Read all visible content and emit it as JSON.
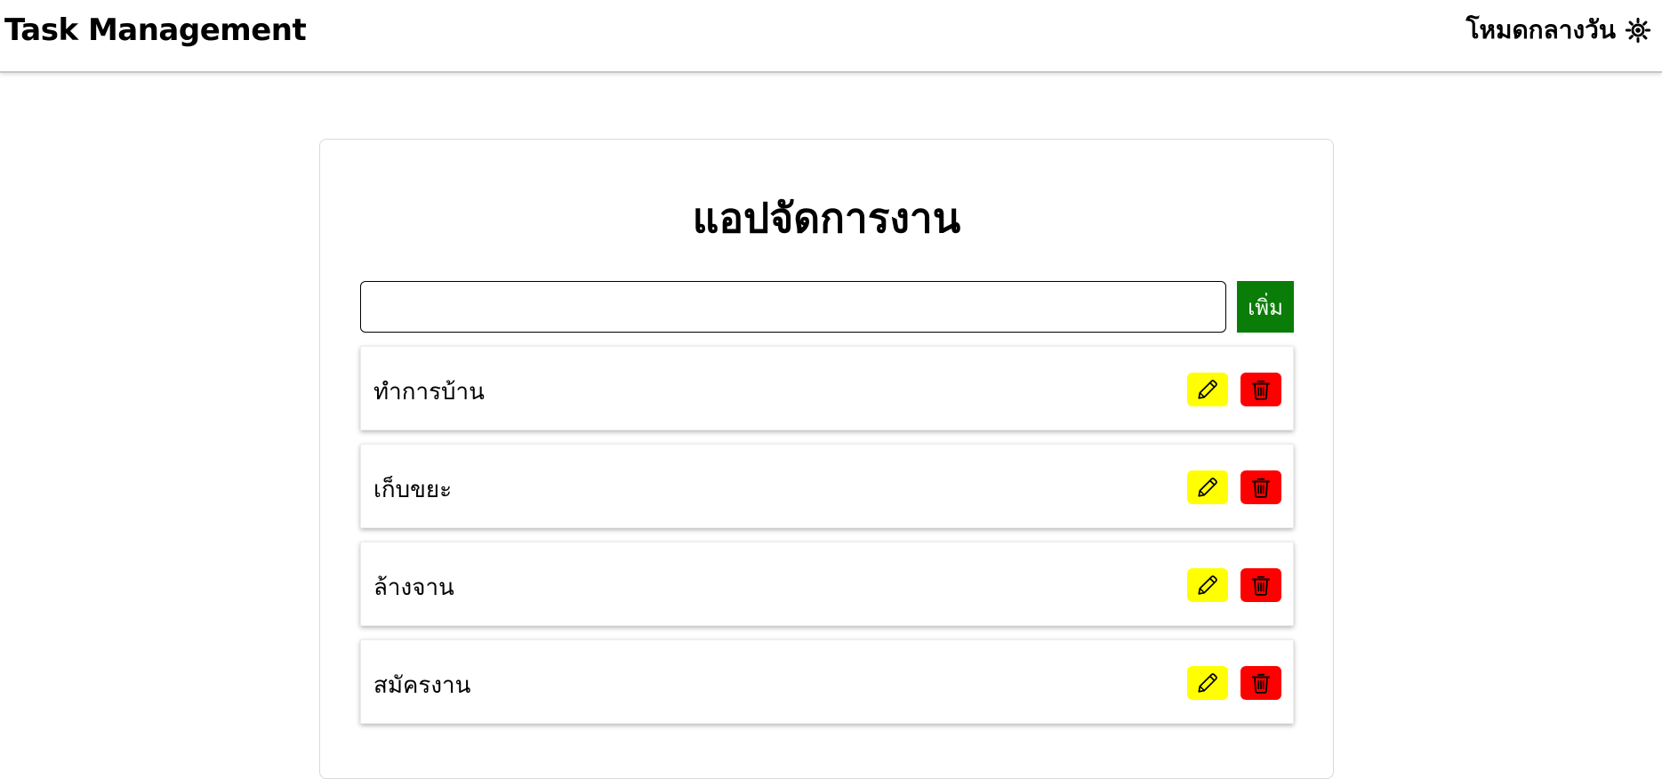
{
  "navbar": {
    "brand": "Task Management",
    "theme_label": "โหมดกลางวัน",
    "theme_icon": "sun-icon"
  },
  "main": {
    "title": "แอปจัดการงาน",
    "input": {
      "value": "",
      "placeholder": ""
    },
    "add_label": "เพิ่ม",
    "tasks": [
      {
        "text": "ทำการบ้าน"
      },
      {
        "text": "เก็บขยะ"
      },
      {
        "text": "ล้างจาน"
      },
      {
        "text": "สมัครงาน"
      }
    ]
  },
  "colors": {
    "add_button": "#0a7d08",
    "edit_button": "#ffff00",
    "delete_button": "#ff0000"
  }
}
